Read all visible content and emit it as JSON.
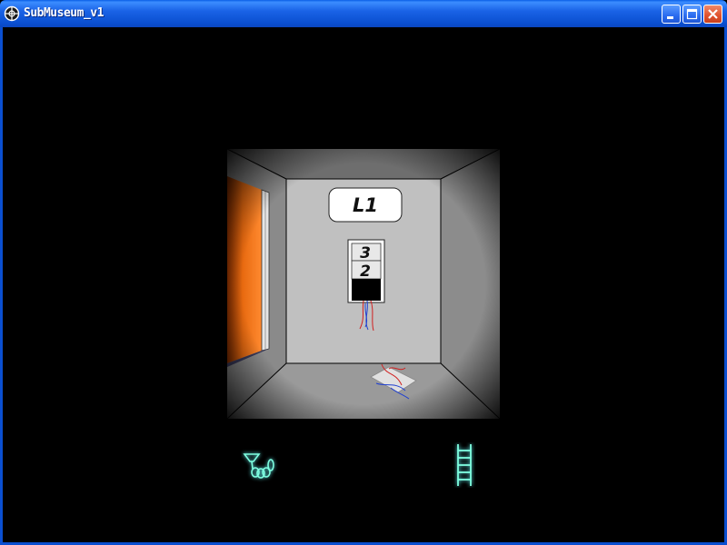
{
  "window": {
    "title": "SubMuseum_v1",
    "buttons": {
      "minimize": "minimize",
      "maximize": "maximize",
      "close": "close"
    }
  },
  "scene": {
    "room": "elevator-interior",
    "floor_sign": "L1",
    "floor_panel": {
      "buttons": [
        "3",
        "2"
      ]
    },
    "colors": {
      "door": "#e86a10",
      "walls": "#8a8a8a",
      "back_wall": "#c0c0c0",
      "accent": "#7fffe0"
    }
  },
  "inventory": {
    "items": [
      {
        "name": "grappling-rope",
        "icon": "rope-hook-icon"
      },
      {
        "name": "ladder",
        "icon": "ladder-icon"
      }
    ]
  }
}
